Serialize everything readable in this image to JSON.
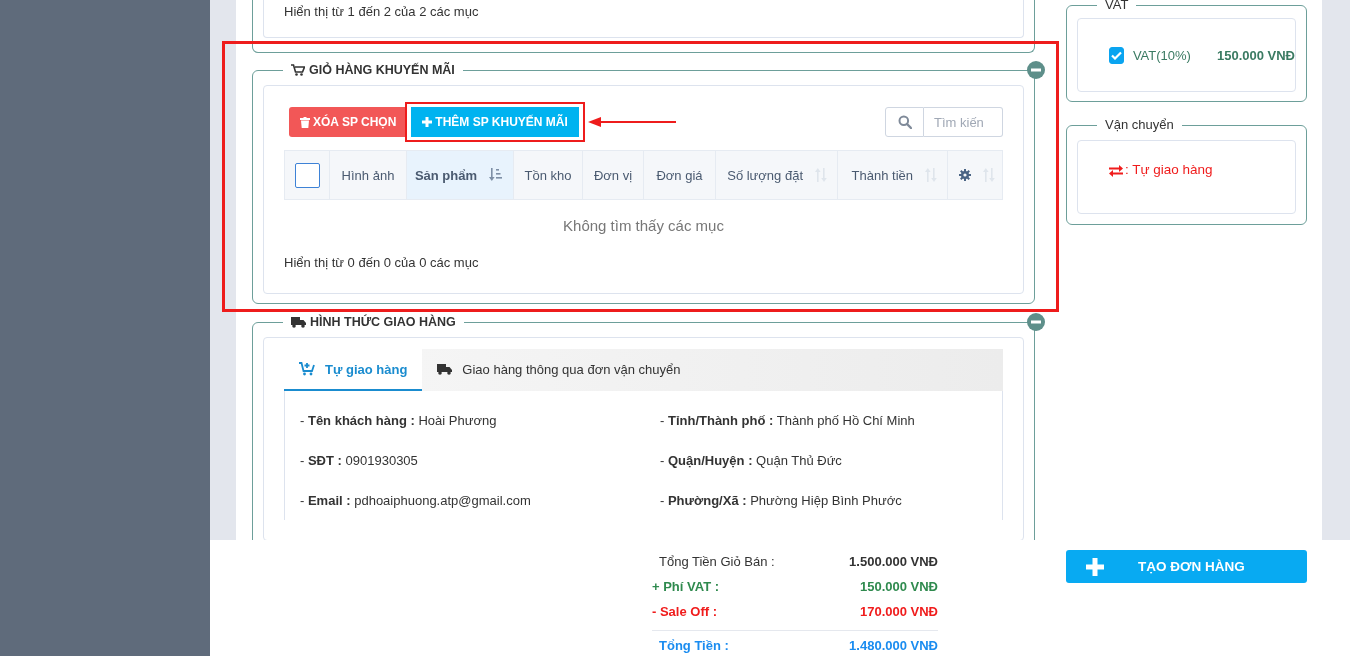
{
  "top_panel": {
    "footer": "Hiển thị từ 1 đến 2 của 2 các mục"
  },
  "promo_cart": {
    "title": "GIỎ HÀNG KHUYẾN MÃI",
    "highlighted": true,
    "buttons": [
      {
        "label": "XÓA SP CHỌN",
        "kind": "danger",
        "highlighted": false
      },
      {
        "label": "THÊM SP KHUYẾN MÃI",
        "kind": "primary",
        "highlighted": true
      }
    ],
    "search": {
      "placeholder": "Tìm kiến"
    },
    "table": {
      "select_all": {
        "checked": false
      },
      "columns": [
        {
          "label": "Hình ảnh",
          "kind": "text",
          "sortable": false,
          "sorted": false
        },
        {
          "label": "Sản phẩm",
          "kind": "text",
          "sortable": true,
          "sorted": true
        },
        {
          "label": "Tồn kho",
          "kind": "text",
          "sortable": false,
          "sorted": false
        },
        {
          "label": "Đơn vị",
          "kind": "text",
          "sortable": false,
          "sorted": false
        },
        {
          "label": "Đơn giá",
          "kind": "text",
          "sortable": false,
          "sorted": false
        },
        {
          "label": "Số lượng đặt",
          "kind": "text",
          "sortable": true,
          "sorted": false
        },
        {
          "label": "Thành tiền",
          "kind": "text",
          "sortable": true,
          "sorted": false
        },
        {
          "kind": "settings",
          "sortable": true,
          "sorted": false
        }
      ],
      "empty_text": "Không tìm thấy các mục"
    },
    "footer": "Hiển thị từ 0 đến 0 của 0 các mục"
  },
  "delivery": {
    "title": "HÌNH THỨC GIAO HÀNG",
    "tabs": [
      {
        "label": "Tự giao hàng",
        "kind": "self",
        "selected": true
      },
      {
        "label": "Giao hàng thông qua đơn vận chuyển",
        "kind": "carrier",
        "selected": false
      }
    ],
    "fields": [
      "- **Tên khách hàng :** Hoài Phương",
      "- **Tỉnh/Thành phố :** Thành phố Hồ Chí Minh",
      "- **SĐT :** 0901930305",
      "- **Quận/Huyện :** Quận Thủ Đức",
      "- **Email :** pdhoaiphuong.atp@gmail.com",
      "- **Phường/Xã :** Phường Hiệp Bình Phước"
    ]
  },
  "vat": {
    "title": "VAT",
    "option": {
      "label": "VAT(10%)",
      "checked": true,
      "amount": "150.000 VNĐ"
    }
  },
  "shipping": {
    "title": "Vận chuyển",
    "method": ": Tự giao hàng"
  },
  "summary": {
    "lines": [
      {
        "label": "Tổng Tiền Giỏ Bán :",
        "value": "1.500.000 VNĐ",
        "kind": "subtotal"
      },
      {
        "label": "+ Phí VAT :",
        "value": "150.000 VNĐ",
        "kind": "add"
      },
      {
        "label": "- Sale Off :",
        "value": "170.000 VNĐ",
        "kind": "discount"
      },
      {
        "label": "Tổng Tiền :",
        "value": "1.480.000 VNĐ",
        "kind": "total"
      }
    ]
  },
  "create_button": {
    "label": "TẠO ĐƠN HÀNG"
  }
}
